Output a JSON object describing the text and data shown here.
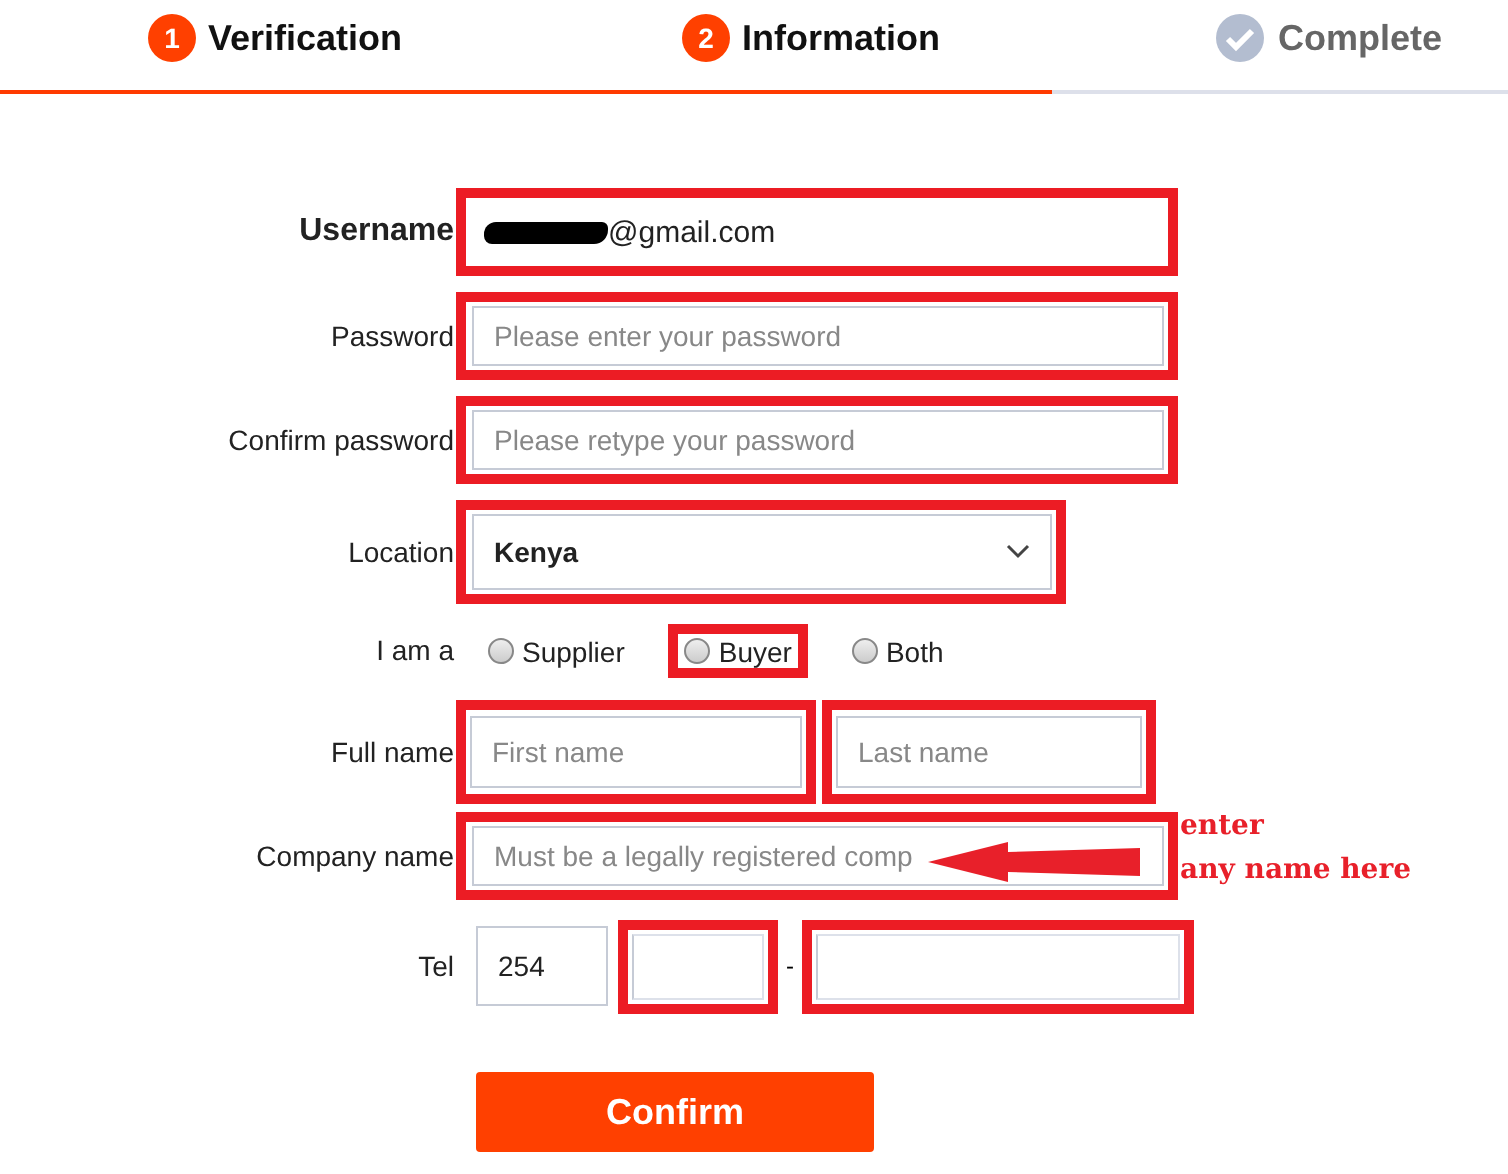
{
  "steps": [
    {
      "kind": "number",
      "number": "1",
      "label": "Verification",
      "active": true
    },
    {
      "kind": "number",
      "number": "2",
      "label": "Information",
      "active": true
    },
    {
      "kind": "check",
      "label": "Complete",
      "active": false
    }
  ],
  "progress": {
    "level": 0.697
  },
  "rows": [
    {
      "kind": "text",
      "label": "Username",
      "label_bold": true,
      "value": "@gmail.com",
      "redacted": true,
      "highlighted": true
    },
    {
      "kind": "text",
      "label": "Password",
      "placeholder": "Please enter your password",
      "highlighted": true
    },
    {
      "kind": "text",
      "label": "Confirm password",
      "placeholder": "Please retype your password",
      "highlighted": true
    },
    {
      "kind": "select",
      "label": "Location",
      "value": "Kenya",
      "highlighted": true
    },
    {
      "kind": "radio",
      "label": "I am a",
      "options": [
        {
          "label": "Supplier",
          "selected": false,
          "highlighted": false
        },
        {
          "label": "Buyer",
          "selected": false,
          "highlighted": true
        },
        {
          "label": "Both",
          "selected": false,
          "highlighted": false
        }
      ]
    },
    {
      "kind": "pair",
      "label": "Full name",
      "fields": [
        {
          "placeholder": "First name",
          "highlighted": true
        },
        {
          "placeholder": "Last name",
          "highlighted": true
        }
      ]
    },
    {
      "kind": "text",
      "label": "Company name",
      "placeholder": "Must be a legally registered comp",
      "highlighted": true,
      "arrow": true,
      "note": [
        "enter",
        "any name here"
      ]
    },
    {
      "kind": "tel",
      "label": "Tel",
      "separator": "-",
      "fields": [
        {
          "value": "254",
          "highlighted": false
        },
        {
          "highlighted": true
        },
        {
          "highlighted": true
        }
      ]
    }
  ],
  "button": {
    "label": "Confirm"
  }
}
